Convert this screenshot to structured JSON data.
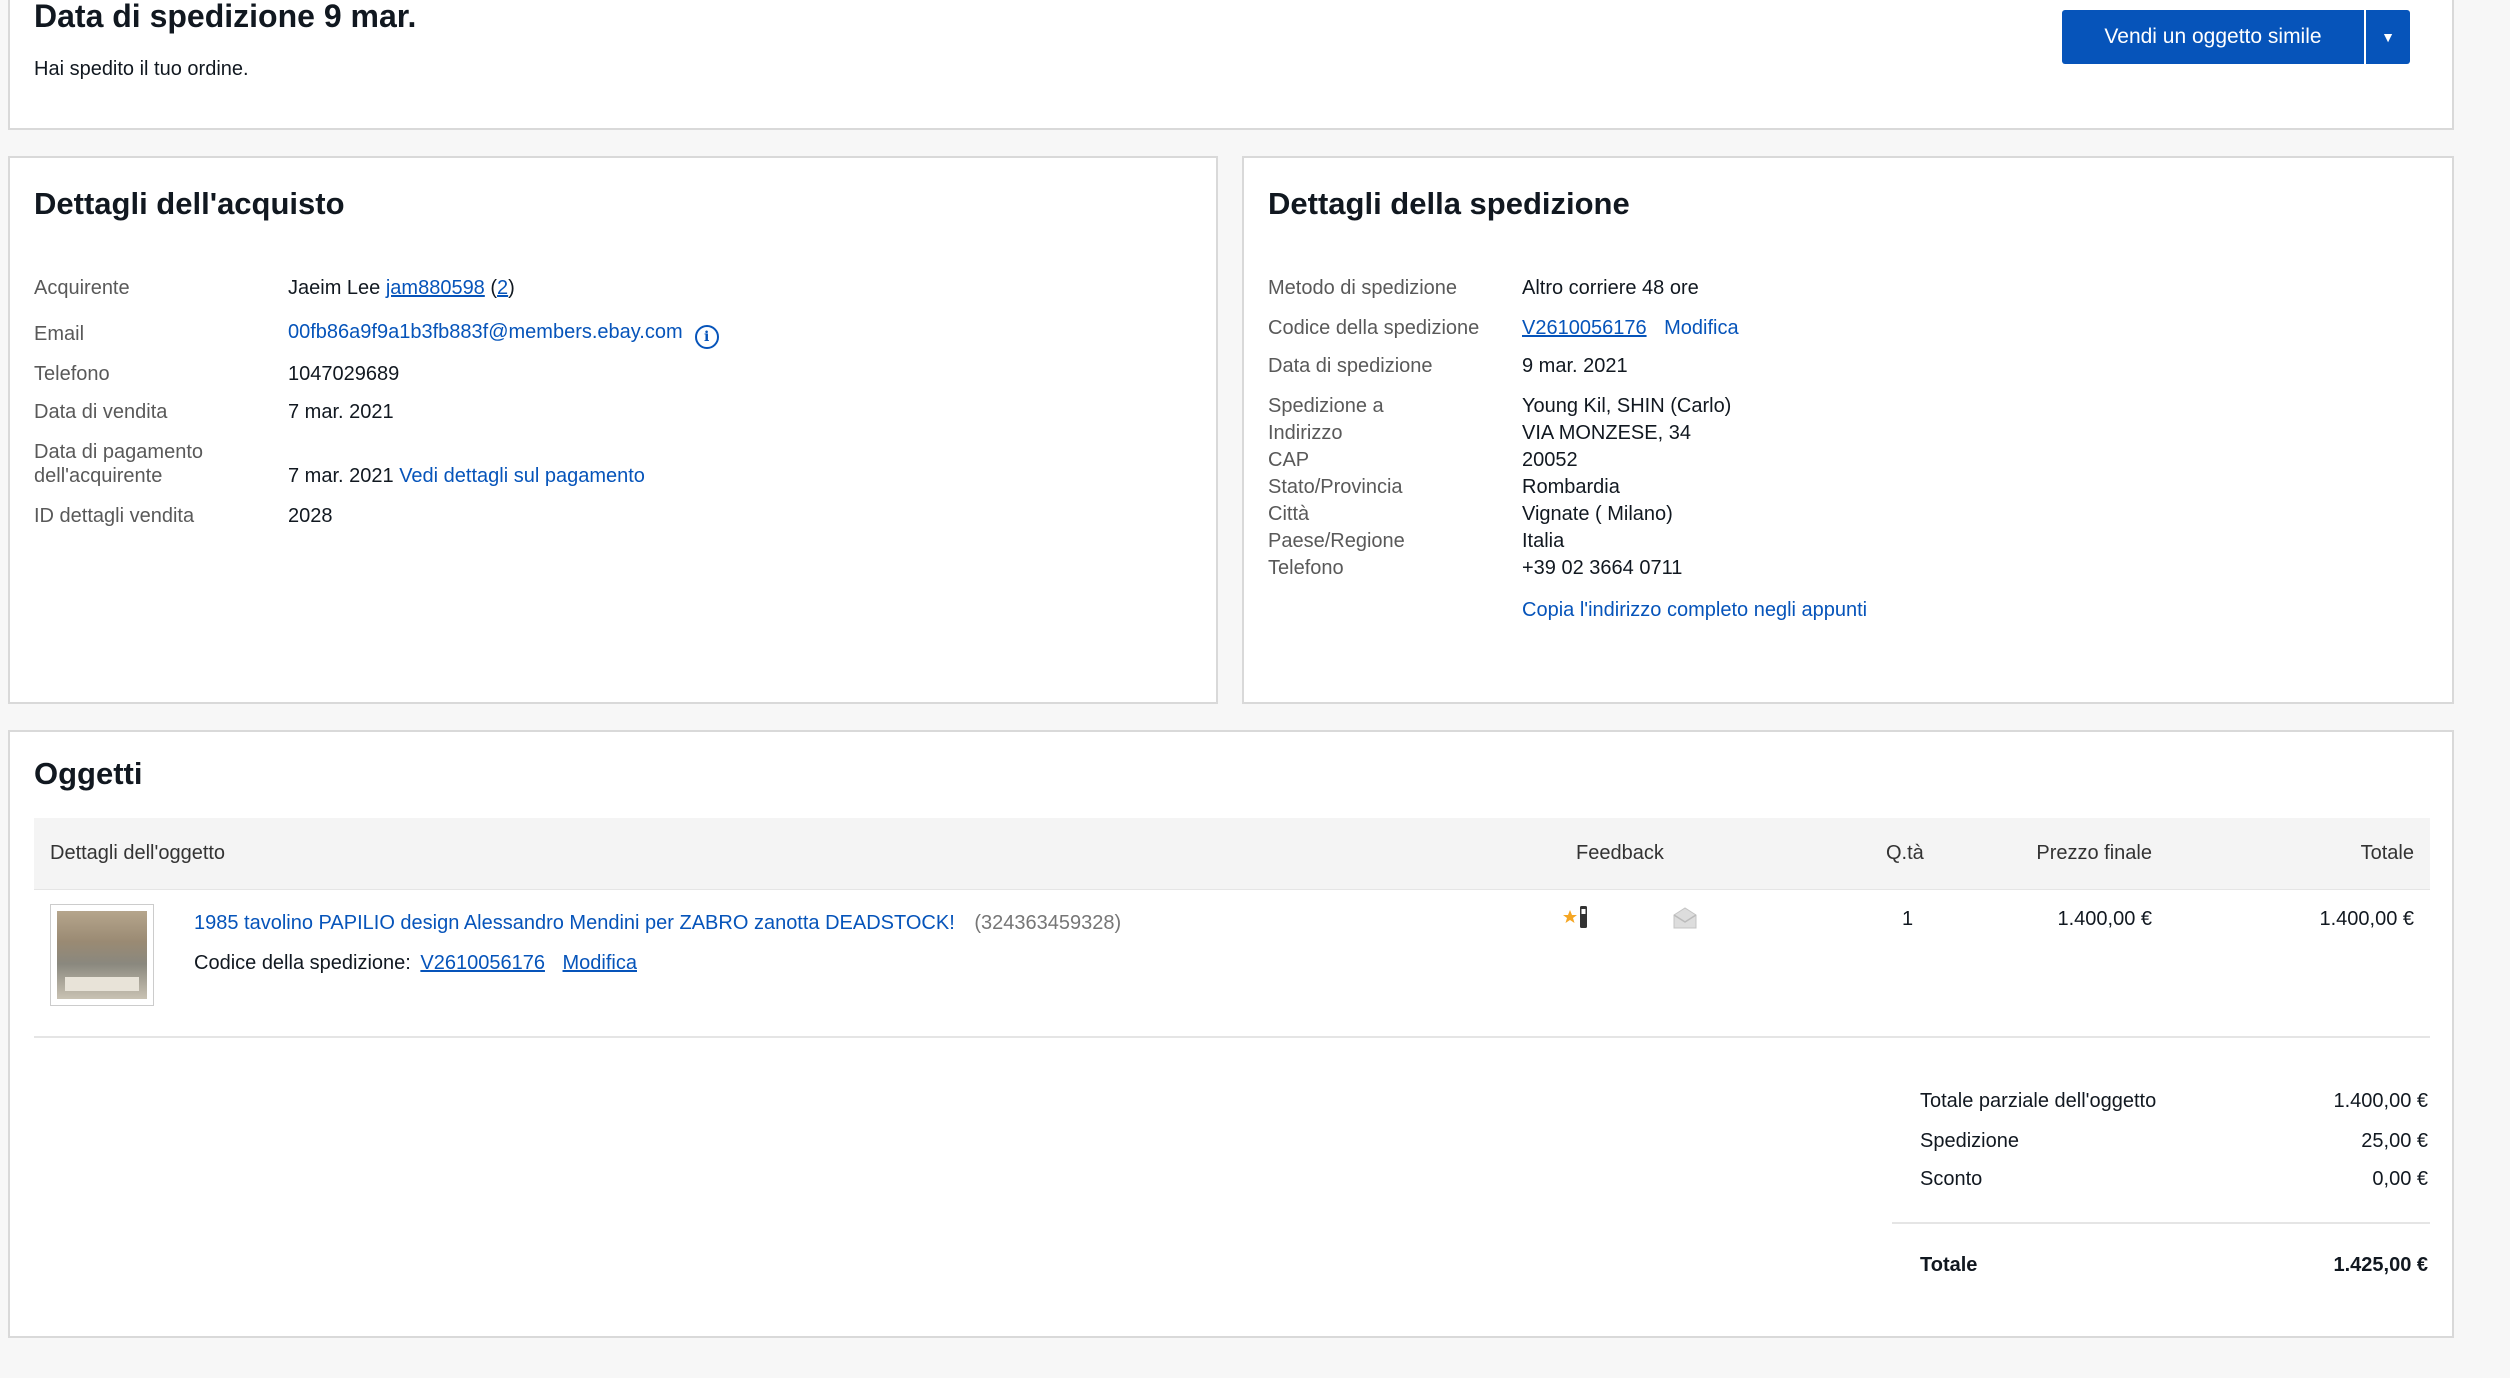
{
  "header": {
    "title": "Data di spedizione 9 mar.",
    "subtitle": "Hai spedito il tuo ordine.",
    "sell_similar_label": "Vendi un oggetto simile"
  },
  "purchase": {
    "title": "Dettagli dell'acquisto",
    "buyer_label": "Acquirente",
    "buyer_name": "Jaeim Lee",
    "buyer_username": "jam880598",
    "buyer_feedback_open": "(",
    "buyer_feedback_count": "2",
    "buyer_feedback_close": ")",
    "email_label": "Email",
    "email_value": "00fb86a9f9a1b3fb883f@members.ebay.com",
    "phone_label": "Telefono",
    "phone_value": "1047029689",
    "sale_date_label": "Data di vendita",
    "sale_date_value": "7 mar. 2021",
    "payment_date_label_line1": "Data di pagamento",
    "payment_date_label_line2": "dell'acquirente",
    "payment_date_value": "7 mar. 2021",
    "payment_details_link": "Vedi dettagli sul pagamento",
    "sale_id_label": "ID dettagli vendita",
    "sale_id_value": "2028"
  },
  "shipping": {
    "title": "Dettagli della spedizione",
    "method_label": "Metodo di spedizione",
    "method_value": "Altro corriere 48 ore",
    "tracking_label": "Codice della spedizione",
    "tracking_value": "V2610056176",
    "edit_link": "Modifica",
    "date_label": "Data di spedizione",
    "date_value": "9 mar. 2021",
    "ship_to_label": "Spedizione a",
    "ship_to_value": "Young Kil, SHIN (Carlo)",
    "address_label": "Indirizzo",
    "address_value": "VIA MONZESE, 34",
    "zip_label": "CAP",
    "zip_value": "20052",
    "state_label": "Stato/Provincia",
    "state_value": "Rombardia",
    "city_label": "Città",
    "city_value": "Vignate ( Milano)",
    "country_label": "Paese/Regione",
    "country_value": "Italia",
    "phone_label": "Telefono",
    "phone_value": "+39 02 3664 0711",
    "copy_address_link": "Copia l'indirizzo completo negli appunti"
  },
  "items": {
    "title": "Oggetti",
    "columns": {
      "details": "Dettagli dell'oggetto",
      "feedback": "Feedback",
      "qty": "Q.tà",
      "final_price": "Prezzo finale",
      "total": "Totale"
    },
    "rows": [
      {
        "title": "1985 tavolino PAPILIO design Alessandro Mendini per ZABRO zanotta DEADSTOCK!",
        "item_id": "(324363459328)",
        "tracking_label": "Codice della spedizione:",
        "tracking_value": "V2610056176",
        "edit_link": "Modifica",
        "qty": "1",
        "final_price": "1.400,00 €",
        "total": "1.400,00 €"
      }
    ],
    "totals": {
      "subtotal_label": "Totale parziale dell'oggetto",
      "subtotal_value": "1.400,00 €",
      "shipping_label": "Spedizione",
      "shipping_value": "25,00 €",
      "discount_label": "Sconto",
      "discount_value": "0,00 €",
      "total_label": "Totale",
      "total_value": "1.425,00 €"
    }
  },
  "colors": {
    "link": "#0654ba",
    "primary_button": "#0654ba",
    "feedback_star": "#f5a623"
  },
  "icons": {
    "info": "info-circle-icon",
    "dropdown": "caret-down-icon",
    "feedback": "feedback-star-icon",
    "message": "envelope-icon"
  }
}
